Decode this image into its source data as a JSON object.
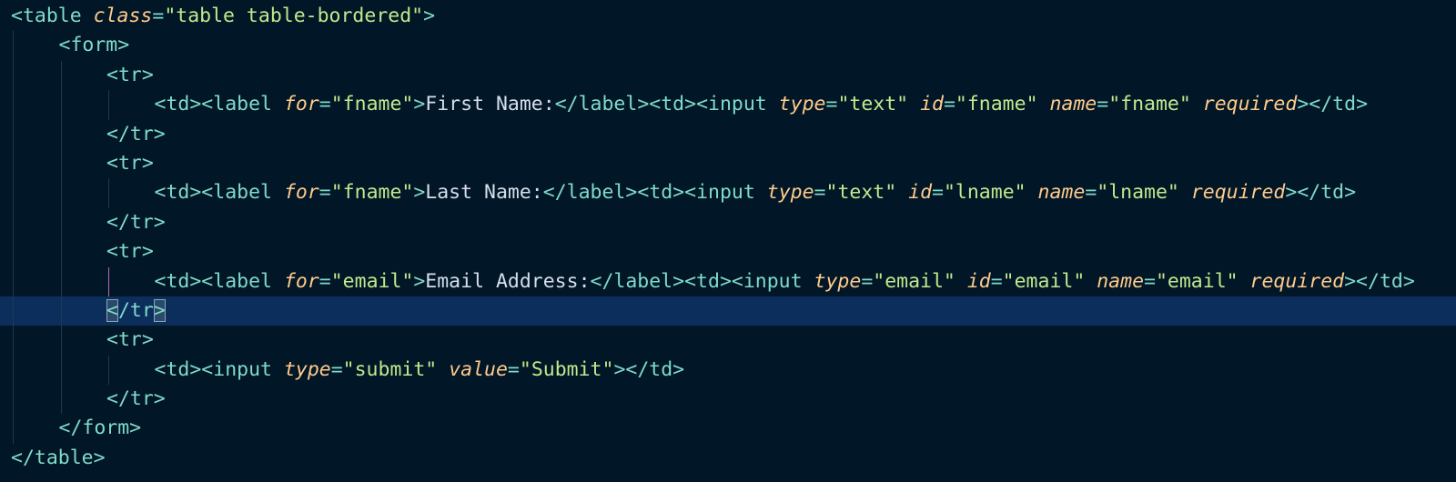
{
  "editor": {
    "lines": [
      {
        "indent": 0,
        "segments": [
          {
            "t": "lt",
            "v": "<"
          },
          {
            "t": "tag-name",
            "v": "table"
          },
          {
            "t": "txt",
            "v": " "
          },
          {
            "t": "attr",
            "v": "class"
          },
          {
            "t": "eq",
            "v": "="
          },
          {
            "t": "str",
            "v": "\"table table-bordered\""
          },
          {
            "t": "gt",
            "v": ">"
          }
        ]
      },
      {
        "indent": 1,
        "segments": [
          {
            "t": "lt",
            "v": "<"
          },
          {
            "t": "tag-name",
            "v": "form"
          },
          {
            "t": "gt",
            "v": ">"
          }
        ]
      },
      {
        "indent": 2,
        "segments": [
          {
            "t": "lt",
            "v": "<"
          },
          {
            "t": "tag-name",
            "v": "tr"
          },
          {
            "t": "gt",
            "v": ">"
          }
        ]
      },
      {
        "indent": 3,
        "segments": [
          {
            "t": "lt",
            "v": "<"
          },
          {
            "t": "tag-name",
            "v": "td"
          },
          {
            "t": "gt",
            "v": ">"
          },
          {
            "t": "lt",
            "v": "<"
          },
          {
            "t": "tag-name",
            "v": "label"
          },
          {
            "t": "txt",
            "v": " "
          },
          {
            "t": "attr",
            "v": "for"
          },
          {
            "t": "eq",
            "v": "="
          },
          {
            "t": "str",
            "v": "\"fname\""
          },
          {
            "t": "gt",
            "v": ">"
          },
          {
            "t": "txt",
            "v": "First Name:"
          },
          {
            "t": "lt",
            "v": "</"
          },
          {
            "t": "tag-name",
            "v": "label"
          },
          {
            "t": "gt",
            "v": ">"
          },
          {
            "t": "lt",
            "v": "<"
          },
          {
            "t": "tag-name",
            "v": "td"
          },
          {
            "t": "gt",
            "v": ">"
          },
          {
            "t": "lt",
            "v": "<"
          },
          {
            "t": "tag-name",
            "v": "input"
          },
          {
            "t": "txt",
            "v": " "
          },
          {
            "t": "attr",
            "v": "type"
          },
          {
            "t": "eq",
            "v": "="
          },
          {
            "t": "str",
            "v": "\"text\""
          },
          {
            "t": "txt",
            "v": " "
          },
          {
            "t": "attr",
            "v": "id"
          },
          {
            "t": "eq",
            "v": "="
          },
          {
            "t": "str",
            "v": "\"fname\""
          },
          {
            "t": "txt",
            "v": " "
          },
          {
            "t": "attr",
            "v": "name"
          },
          {
            "t": "eq",
            "v": "="
          },
          {
            "t": "str",
            "v": "\"fname\""
          },
          {
            "t": "txt",
            "v": " "
          },
          {
            "t": "attr",
            "v": "required"
          },
          {
            "t": "gt",
            "v": ">"
          },
          {
            "t": "lt",
            "v": "</"
          },
          {
            "t": "tag-name",
            "v": "td"
          },
          {
            "t": "gt",
            "v": ">"
          }
        ]
      },
      {
        "indent": 2,
        "segments": [
          {
            "t": "lt",
            "v": "</"
          },
          {
            "t": "tag-name",
            "v": "tr"
          },
          {
            "t": "gt",
            "v": ">"
          }
        ]
      },
      {
        "indent": 2,
        "segments": [
          {
            "t": "lt",
            "v": "<"
          },
          {
            "t": "tag-name",
            "v": "tr"
          },
          {
            "t": "gt",
            "v": ">"
          }
        ]
      },
      {
        "indent": 3,
        "segments": [
          {
            "t": "lt",
            "v": "<"
          },
          {
            "t": "tag-name",
            "v": "td"
          },
          {
            "t": "gt",
            "v": ">"
          },
          {
            "t": "lt",
            "v": "<"
          },
          {
            "t": "tag-name",
            "v": "label"
          },
          {
            "t": "txt",
            "v": " "
          },
          {
            "t": "attr",
            "v": "for"
          },
          {
            "t": "eq",
            "v": "="
          },
          {
            "t": "str",
            "v": "\"fname\""
          },
          {
            "t": "gt",
            "v": ">"
          },
          {
            "t": "txt",
            "v": "Last Name:"
          },
          {
            "t": "lt",
            "v": "</"
          },
          {
            "t": "tag-name",
            "v": "label"
          },
          {
            "t": "gt",
            "v": ">"
          },
          {
            "t": "lt",
            "v": "<"
          },
          {
            "t": "tag-name",
            "v": "td"
          },
          {
            "t": "gt",
            "v": ">"
          },
          {
            "t": "lt",
            "v": "<"
          },
          {
            "t": "tag-name",
            "v": "input"
          },
          {
            "t": "txt",
            "v": " "
          },
          {
            "t": "attr",
            "v": "type"
          },
          {
            "t": "eq",
            "v": "="
          },
          {
            "t": "str",
            "v": "\"text\""
          },
          {
            "t": "txt",
            "v": " "
          },
          {
            "t": "attr",
            "v": "id"
          },
          {
            "t": "eq",
            "v": "="
          },
          {
            "t": "str",
            "v": "\"lname\""
          },
          {
            "t": "txt",
            "v": " "
          },
          {
            "t": "attr",
            "v": "name"
          },
          {
            "t": "eq",
            "v": "="
          },
          {
            "t": "str",
            "v": "\"lname\""
          },
          {
            "t": "txt",
            "v": " "
          },
          {
            "t": "attr",
            "v": "required"
          },
          {
            "t": "gt",
            "v": ">"
          },
          {
            "t": "lt",
            "v": "</"
          },
          {
            "t": "tag-name",
            "v": "td"
          },
          {
            "t": "gt",
            "v": ">"
          }
        ]
      },
      {
        "indent": 2,
        "segments": [
          {
            "t": "lt",
            "v": "</"
          },
          {
            "t": "tag-name",
            "v": "tr"
          },
          {
            "t": "gt",
            "v": ">"
          }
        ]
      },
      {
        "indent": 2,
        "segments": [
          {
            "t": "lt",
            "v": "<"
          },
          {
            "t": "tag-name",
            "v": "tr"
          },
          {
            "t": "gt",
            "v": ">"
          }
        ]
      },
      {
        "indent": 3,
        "guide_highlight": true,
        "segments": [
          {
            "t": "lt",
            "v": "<"
          },
          {
            "t": "tag-name",
            "v": "td"
          },
          {
            "t": "gt",
            "v": ">"
          },
          {
            "t": "lt",
            "v": "<"
          },
          {
            "t": "tag-name",
            "v": "label"
          },
          {
            "t": "txt",
            "v": " "
          },
          {
            "t": "attr",
            "v": "for"
          },
          {
            "t": "eq",
            "v": "="
          },
          {
            "t": "str",
            "v": "\"email\""
          },
          {
            "t": "gt",
            "v": ">"
          },
          {
            "t": "txt",
            "v": "Email Address:"
          },
          {
            "t": "lt",
            "v": "</"
          },
          {
            "t": "tag-name",
            "v": "label"
          },
          {
            "t": "gt",
            "v": ">"
          },
          {
            "t": "lt",
            "v": "<"
          },
          {
            "t": "tag-name",
            "v": "td"
          },
          {
            "t": "gt",
            "v": ">"
          },
          {
            "t": "lt",
            "v": "<"
          },
          {
            "t": "tag-name",
            "v": "input"
          },
          {
            "t": "txt",
            "v": " "
          },
          {
            "t": "attr",
            "v": "type"
          },
          {
            "t": "eq",
            "v": "="
          },
          {
            "t": "str",
            "v": "\"email\""
          },
          {
            "t": "txt",
            "v": " "
          },
          {
            "t": "attr",
            "v": "id"
          },
          {
            "t": "eq",
            "v": "="
          },
          {
            "t": "str",
            "v": "\"email\""
          },
          {
            "t": "txt",
            "v": " "
          },
          {
            "t": "attr",
            "v": "name"
          },
          {
            "t": "eq",
            "v": "="
          },
          {
            "t": "str",
            "v": "\"email\""
          },
          {
            "t": "txt",
            "v": " "
          },
          {
            "t": "attr",
            "v": "required"
          },
          {
            "t": "gt",
            "v": ">"
          },
          {
            "t": "lt",
            "v": "</"
          },
          {
            "t": "tag-name",
            "v": "td"
          },
          {
            "t": "gt",
            "v": ">"
          }
        ]
      },
      {
        "indent": 2,
        "active": true,
        "segments": [
          {
            "t": "lt",
            "v": "<",
            "box": true
          },
          {
            "t": "lt",
            "v": "/"
          },
          {
            "t": "tag-name",
            "v": "tr"
          },
          {
            "t": "gt",
            "v": ">",
            "box": true
          }
        ]
      },
      {
        "indent": 2,
        "segments": [
          {
            "t": "lt",
            "v": "<"
          },
          {
            "t": "tag-name",
            "v": "tr"
          },
          {
            "t": "gt",
            "v": ">"
          }
        ]
      },
      {
        "indent": 3,
        "segments": [
          {
            "t": "lt",
            "v": "<"
          },
          {
            "t": "tag-name",
            "v": "td"
          },
          {
            "t": "gt",
            "v": ">"
          },
          {
            "t": "lt",
            "v": "<"
          },
          {
            "t": "tag-name",
            "v": "input"
          },
          {
            "t": "txt",
            "v": " "
          },
          {
            "t": "attr",
            "v": "type"
          },
          {
            "t": "eq",
            "v": "="
          },
          {
            "t": "str",
            "v": "\"submit\""
          },
          {
            "t": "txt",
            "v": " "
          },
          {
            "t": "attr",
            "v": "value"
          },
          {
            "t": "eq",
            "v": "="
          },
          {
            "t": "str",
            "v": "\"Submit\""
          },
          {
            "t": "gt",
            "v": ">"
          },
          {
            "t": "lt",
            "v": "</"
          },
          {
            "t": "tag-name",
            "v": "td"
          },
          {
            "t": "gt",
            "v": ">"
          }
        ]
      },
      {
        "indent": 2,
        "segments": [
          {
            "t": "lt",
            "v": "</"
          },
          {
            "t": "tag-name",
            "v": "tr"
          },
          {
            "t": "gt",
            "v": ">"
          }
        ]
      },
      {
        "indent": 1,
        "segments": [
          {
            "t": "lt",
            "v": "</"
          },
          {
            "t": "tag-name",
            "v": "form"
          },
          {
            "t": "gt",
            "v": ">"
          }
        ]
      },
      {
        "indent": 0,
        "segments": [
          {
            "t": "lt",
            "v": "</"
          },
          {
            "t": "tag-name",
            "v": "table"
          },
          {
            "t": "gt",
            "v": ">"
          }
        ]
      }
    ]
  },
  "theme": {
    "background": "#011627",
    "active_line": "#0b2e5c",
    "tag": "#7fdbca",
    "attribute": "#ffcb8b",
    "string": "#c3e88d",
    "text": "#d6deeb",
    "indent_guide": "#1b3a52",
    "indent_guide_active": "#b26ab8"
  }
}
